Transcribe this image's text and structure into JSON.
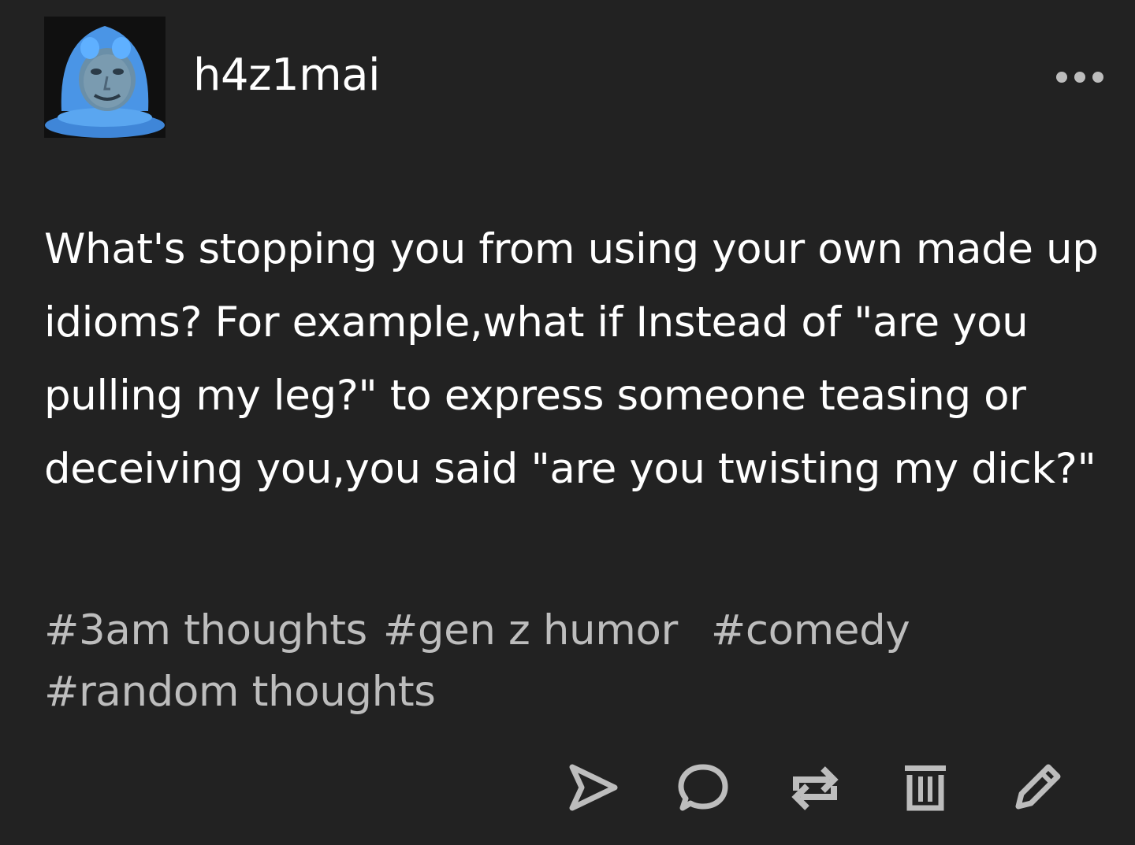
{
  "post": {
    "username": "h4z1mai",
    "body": "What's stopping you from using your own made up idioms? For example,what if Instead of \"are you pulling my leg?\" to express someone teasing or deceiving you,you said \"are you twisting my dick?\"",
    "tags": [
      "#3am thoughts",
      "#gen z humor",
      "#comedy",
      "#random thoughts"
    ]
  },
  "icons": {
    "avatar": "avatar-image",
    "more": "more-icon",
    "share": "send-icon",
    "reply": "comment-icon",
    "reblog": "reblog-icon",
    "delete": "trash-icon",
    "edit": "pencil-icon"
  },
  "colors": {
    "background": "#222222",
    "text": "#ffffff",
    "tags": "#bdbdbd",
    "icons": "#bdbdbd",
    "avatar_blue": "#4a90e2"
  }
}
